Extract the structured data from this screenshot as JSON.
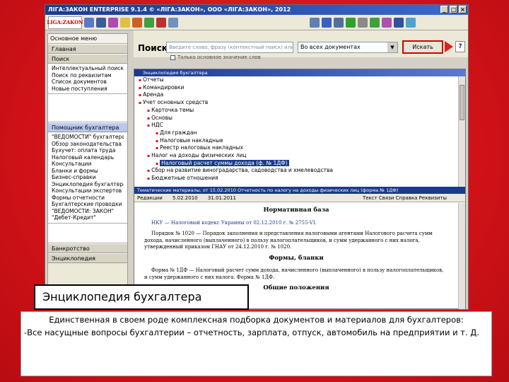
{
  "window": {
    "title": "ЛІГА:ЗАКОН ENTERPRISE 9.1.4 © «ЛІГА:ЗАКОН», ООО «ЛІГА:ЗАКОН», 2012",
    "controls": [
      "_",
      "□",
      "×"
    ]
  },
  "toolbar": {
    "logo_text": "LIGA:ZAKON"
  },
  "search": {
    "label": "Поиск:",
    "placeholder": "Введите слово, фразу (контекстный поиск) или номер",
    "scope_value": "Во всех документах",
    "button": "Искать",
    "checkbox_label": "Только основное значение слов",
    "help": "?"
  },
  "sidebar": {
    "header": "Основное меню",
    "sections": [
      {
        "title": "Главная"
      },
      {
        "title": "Поиск",
        "items": [
          "Интеллектуальный поиск",
          "Поиск по реквизитам",
          "Список документов",
          "Новые поступления"
        ]
      },
      {
        "title": "Помощник бухгалтера",
        "items": [
          "\"ВЕДОМОСТИ\" бухгалтера",
          "Обзор законодательства",
          "Бухучет: оплата труда",
          "Налоговый календарь",
          "Консультации",
          "Бланки и формы",
          "Бизнес-справки",
          "Энциклопедия бухгалтера",
          "Консультации экспертов",
          "Формы отчетности",
          "Бухгалтерские проводки",
          "\"ВЕДОМОСТИ: ЗАКОН\"",
          "\"Дебет-Кредит\""
        ]
      },
      {
        "title": "Банкротство"
      },
      {
        "title": "Энциклопедия"
      }
    ]
  },
  "doc": {
    "panel_title": "Энциклопедия бухгалтера",
    "tree": [
      {
        "text": "Отчеты",
        "level": 0
      },
      {
        "text": "Командировки",
        "level": 0
      },
      {
        "text": "Аренда",
        "level": 0
      },
      {
        "text": "Учет основных средств",
        "level": 0
      },
      {
        "text": "Карточка темы",
        "level": 1
      },
      {
        "text": "Основы",
        "level": 1
      },
      {
        "text": "НДС",
        "level": 1
      },
      {
        "text": "Для граждан",
        "level": 2
      },
      {
        "text": "Налоговые накладные",
        "level": 2
      },
      {
        "text": "Реестр налоговых накладных",
        "level": 2
      },
      {
        "text": "Налог на доходы физических лиц",
        "level": 1
      },
      {
        "text": "Налоговый расчет суммы дохода (ф. № 1ДФ)",
        "level": 2,
        "selected": true
      },
      {
        "text": "Сбор на развитие виноградарства, садоводства и хмелеводства",
        "level": 1
      },
      {
        "text": "Бюджетные отношения",
        "level": 1
      }
    ],
    "status_bar": "Тематические материалы, от 15.02.2010 Отчетность по налогу на доходы физических лиц (форма № 1ДФ)",
    "doc_toolbar": [
      "Редакции",
      "5.02.2010",
      "31.01.2011"
    ],
    "doc_toolbar_right": "Текст  Связи  Справка  Реквизиты",
    "heading1": "Нормативная база",
    "para1": "НКУ — Налоговый кодекс Украины от 02.12.2010 г. № 2755-VI.",
    "para2": "Порядок № 1020 — Порядок заполнения и представления налоговыми агентами Налогового расчета сумм дохода, начисленного (выплаченного) в пользу налогоплательщиков, и сумм удержанного с них налога, утвержденный приказом ГНАУ от 24.12.2010 г. № 1020.",
    "heading2": "Формы, бланки",
    "para3": "Форма № 1ДФ — Налоговый расчет сумм дохода, начисленного (выплаченного) в пользу налогоплательщиков, и сумм удержанного с них налога. Форма № 1ДФ.",
    "heading3": "Общие положения"
  },
  "slide": {
    "caption": "Энциклопедия бухгалтера",
    "text_line1": "Единственная в своем роде комплексная подборка документов и материалов для бухгалтеров:",
    "text_line2": "-Все насущные вопросы бухгалтерии – отчетность, зарплата, отпуск, автомобиль на предприятии и т. Д."
  },
  "colors": {
    "accent_red": "#d11218",
    "title_blue": "#1a3a8c",
    "selection_blue": "#1a3a8c"
  }
}
